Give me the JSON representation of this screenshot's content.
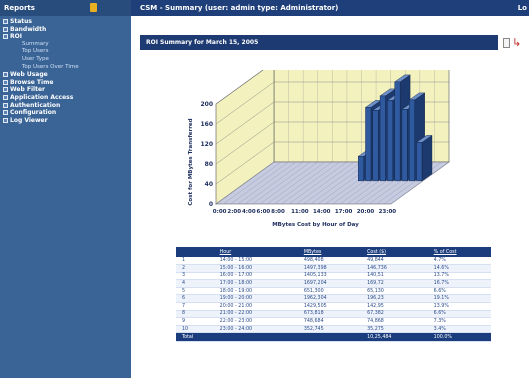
{
  "sidebar": {
    "header": "Reports",
    "items": [
      {
        "label": "Status",
        "type": "group"
      },
      {
        "label": "Bandwidth",
        "type": "group"
      },
      {
        "label": "ROI",
        "type": "group"
      },
      {
        "label": "Summary",
        "type": "sub"
      },
      {
        "label": "Top Users",
        "type": "sub"
      },
      {
        "label": "User Type",
        "type": "sub"
      },
      {
        "label": "Top Users Over Time",
        "type": "sub"
      },
      {
        "label": "Web Usage",
        "type": "group"
      },
      {
        "label": "Browse Time",
        "type": "group"
      },
      {
        "label": "Web Filter",
        "type": "group"
      },
      {
        "label": "Application Access",
        "type": "group"
      },
      {
        "label": "Authentication",
        "type": "group"
      },
      {
        "label": "Configuration",
        "type": "group"
      },
      {
        "label": "Log Viewer",
        "type": "group"
      }
    ]
  },
  "main": {
    "title": "CSM - Summary  (user:  admin   type:  Administrator)",
    "logout": "Lo",
    "report_title": "ROI Summary for March 15, 2005"
  },
  "chart_data": {
    "type": "bar",
    "ylabel": "Cost for MBytes Transferred",
    "xlabel": "MBytes Cost by Hour of Day",
    "ylim": [
      0,
      200
    ],
    "yticks": [
      "0",
      "40",
      "80",
      "120",
      "160",
      "200"
    ],
    "xticks": [
      "0:00",
      "2:00",
      "4:00",
      "6:00",
      "8:00",
      "11:00",
      "14:00",
      "17:00",
      "20:00",
      "23:00"
    ],
    "hours": [
      "0",
      "1",
      "2",
      "3",
      "4",
      "5",
      "6",
      "7",
      "8",
      "9",
      "10",
      "11",
      "12",
      "13",
      "14",
      "15",
      "16",
      "17",
      "18",
      "19",
      "20",
      "21",
      "22",
      "23"
    ],
    "values": [
      0,
      0,
      0,
      0,
      0,
      0,
      0,
      0,
      0,
      0,
      0,
      0,
      0,
      0,
      0,
      49,
      147,
      141,
      170,
      161,
      198,
      143,
      162,
      77
    ],
    "bar_color": "#2f5aa0",
    "floor_color": "#c7cbe0",
    "wall_color": "#f3f1be"
  },
  "table": {
    "headers": [
      "Hour",
      "MBytes",
      "Cost ($)",
      "% of Cost"
    ],
    "rows": [
      [
        "1",
        "14:00 - 15:00",
        "498,408",
        "49,844",
        "4.7%"
      ],
      [
        "2",
        "15:00 - 16:00",
        "1497,398",
        "146,736",
        "14.6%"
      ],
      [
        "3",
        "16:00 - 17:00",
        "1405,133",
        "140,51",
        "13.7%"
      ],
      [
        "4",
        "17:00 - 18:00",
        "1697,204",
        "169,72",
        "16.7%"
      ],
      [
        "5",
        "18:00 - 19:00",
        "651,300",
        "65,130",
        "6.6%"
      ],
      [
        "6",
        "19:00 - 20:00",
        "1962,304",
        "196,23",
        "19.1%"
      ],
      [
        "7",
        "20:00 - 21:00",
        "1429,505",
        "142,95",
        "13.9%"
      ],
      [
        "8",
        "21:00 - 22:00",
        "673,818",
        "67,382",
        "6.6%"
      ],
      [
        "9",
        "22:00 - 23:00",
        "748,684",
        "74,868",
        "7.3%"
      ],
      [
        "10",
        "23:00 - 24:00",
        "352,745",
        "35,275",
        "3.4%"
      ]
    ],
    "total": [
      "Total",
      "",
      "",
      "10,25,484",
      "100.0%"
    ]
  }
}
